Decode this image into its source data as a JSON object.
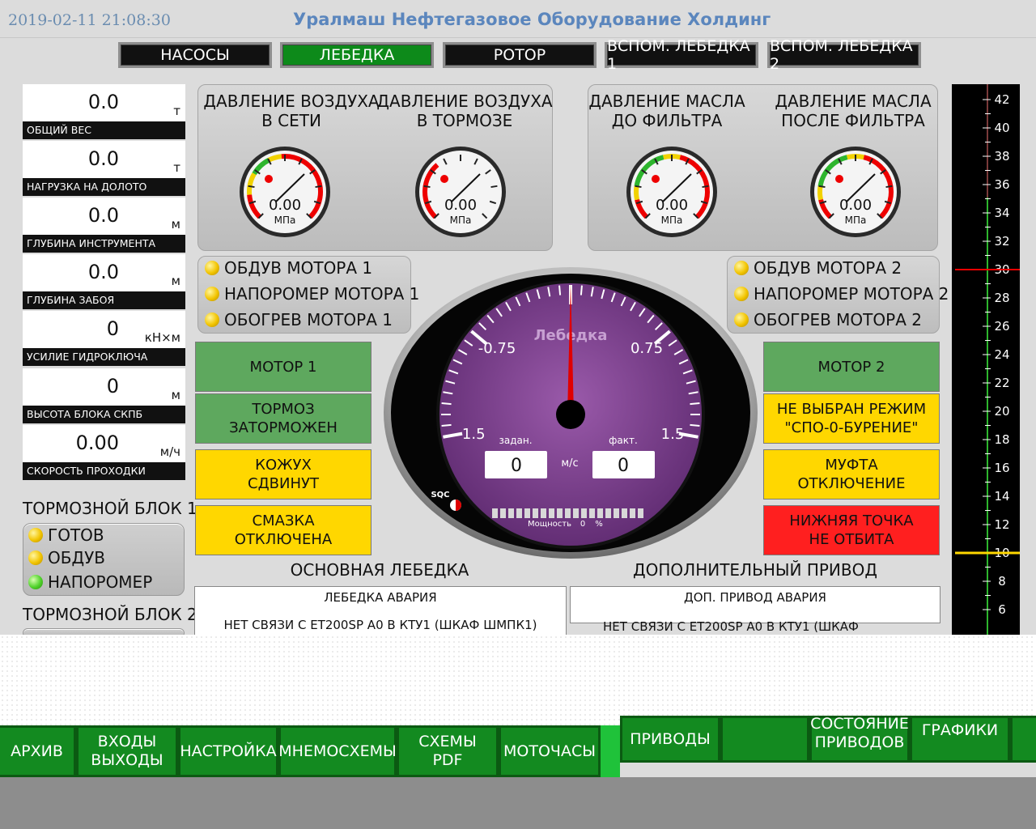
{
  "header": {
    "timestamp": "2019-02-11 21:08:30",
    "title": "Уралмаш Нефтегазовое Оборудование Холдинг"
  },
  "tabs": [
    {
      "label": "НАСОСЫ",
      "active": false
    },
    {
      "label": "ЛЕБЕДКА",
      "active": true
    },
    {
      "label": "РОТОР",
      "active": false
    },
    {
      "label": "ВСПОМ. ЛЕБЕДКА 1",
      "active": false
    },
    {
      "label": "ВСПОМ. ЛЕБЕДКА 2",
      "active": false
    }
  ],
  "readouts": [
    {
      "value": "0.0",
      "unit": "т",
      "label": "ОБЩИЙ ВЕС"
    },
    {
      "value": "0.0",
      "unit": "т",
      "label": "НАГРУЗКА НА ДОЛОТО"
    },
    {
      "value": "0.0",
      "unit": "м",
      "label": "ГЛУБИНА ИНСТРУМЕНТА"
    },
    {
      "value": "0.0",
      "unit": "м",
      "label": "ГЛУБИНА ЗАБОЯ"
    },
    {
      "value": "0",
      "unit": "кН×м",
      "label": "УСИЛИЕ ГИДРОКЛЮЧА"
    },
    {
      "value": "0",
      "unit": "м",
      "label": "ВЫСОТА БЛОКА СКПБ"
    },
    {
      "value": "0.00",
      "unit": "м/ч",
      "label": "СКОРОСТЬ ПРОХОДКИ"
    }
  ],
  "brake1": {
    "title": "ТОРМОЗНОЙ БЛОК 1",
    "items": [
      {
        "label": "ГОТОВ",
        "color": "yellow"
      },
      {
        "label": "ОБДУВ",
        "color": "yellow"
      },
      {
        "label": "НАПОРОМЕР",
        "color": "green"
      }
    ]
  },
  "brake2": {
    "title": "ТОРМОЗНОЙ БЛОК 2"
  },
  "gauges": [
    {
      "title_1": "ДАВЛЕНИЕ ВОЗДУХА",
      "title_2": "В СЕТИ",
      "value": "0.00",
      "unit": "МПа"
    },
    {
      "title_1": "ДАВЛЕНИЕ ВОЗДУХА",
      "title_2": "В ТОРМОЗЕ",
      "value": "0.00",
      "unit": "МПа"
    },
    {
      "title_1": "ДАВЛЕНИЕ МАСЛА",
      "title_2": "ДО ФИЛЬТРА",
      "value": "0.00",
      "unit": "МПа"
    },
    {
      "title_1": "ДАВЛЕНИЕ МАСЛА",
      "title_2": "ПОСЛЕ ФИЛЬТРА",
      "value": "0.00",
      "unit": "МПа"
    }
  ],
  "motor1_status": [
    "ОБДУВ МОТОРА 1",
    "НАПОРОМЕР МОТОРА 1",
    "ОБОГРЕВ МОТОРА 1"
  ],
  "motor2_status": [
    "ОБДУВ МОТОРА 2",
    "НАПОРОМЕР МОТОРА 2",
    "ОБОГРЕВ МОТОРА 2"
  ],
  "left_boxes": [
    {
      "l1": "МОТОР 1",
      "l2": "",
      "color": "green"
    },
    {
      "l1": "ТОРМОЗ",
      "l2": "ЗАТОРМОЖЕН",
      "color": "green"
    },
    {
      "l1": "КОЖУХ",
      "l2": "СДВИНУТ",
      "color": "yellow"
    },
    {
      "l1": "СМАЗКА",
      "l2": "ОТКЛЮЧЕНА",
      "color": "yellow"
    }
  ],
  "right_boxes": [
    {
      "l1": "МОТОР 2",
      "l2": "",
      "color": "green"
    },
    {
      "l1": "НЕ ВЫБРАН РЕЖИМ",
      "l2": "\"СПО-0-БУРЕНИЕ\"",
      "color": "yellow"
    },
    {
      "l1": "МУФТА",
      "l2": "ОТКЛЮЧЕНИЕ",
      "color": "yellow"
    },
    {
      "l1": "НИЖНЯЯ ТОЧКА",
      "l2": "НЕ ОТБИТА",
      "color": "red"
    }
  ],
  "dial": {
    "name": "Лебедка",
    "ticks": [
      "-1.5",
      "-0.75",
      "0.75",
      "1.5"
    ],
    "set_label": "задан.",
    "set_value": "0",
    "unit": "м/с",
    "fact_label": "факт.",
    "fact_value": "0",
    "brand": "SQC",
    "power_label": "Мощность",
    "power_value": "0",
    "power_unit": "%",
    "value": 0
  },
  "sections": {
    "main": "ОСНОВНАЯ ЛЕБЕДКА",
    "aux": "ДОПОЛНИТЕЛЬНЫЙ ПРИВОД"
  },
  "alarms": {
    "main_title": "ЛЕБЕДКА АВАРИЯ",
    "main_msg": "НЕТ СВЯЗИ С ET200SP A0 В КТУ1 (ШКАФ ШМПК1)",
    "aux_title": "ДОП. ПРИВОД АВАРИЯ",
    "aux_msg": "НЕТ СВЯЗИ С ET200SP A0 В КТУ1 (ШКАФ"
  },
  "scale": {
    "labels": [
      "42",
      "40",
      "38",
      "36",
      "34",
      "32",
      "30",
      "28",
      "26",
      "24",
      "22",
      "20",
      "18",
      "16",
      "14",
      "12",
      "10",
      "8",
      "6"
    ],
    "red_marker": 30,
    "yellow_marker": 10
  },
  "bottom_nav": {
    "archive": "АРХИВ",
    "io_1": "ВХОДЫ",
    "io_2": "ВЫХОДЫ",
    "settings": "НАСТРОЙКА",
    "mnemo": "МНЕМОСХЕМЫ",
    "pdf_1": "СХЕМЫ",
    "pdf_2": "PDF",
    "hours": "МОТОЧАСЫ",
    "drives": "ПРИВОДЫ",
    "drive_state_1": "СОСТОЯНИЕ",
    "drive_state_2": "ПРИВОДОВ",
    "graphs": "ГРАФИКИ"
  },
  "colors": {
    "active_tab": "#0d8a1a",
    "dial_face": "#7e3f8e",
    "needle": "#e00000",
    "alarm_red": "#ff1f1f",
    "warn_yellow": "#ffd700",
    "ok_green": "#5ea85e"
  }
}
